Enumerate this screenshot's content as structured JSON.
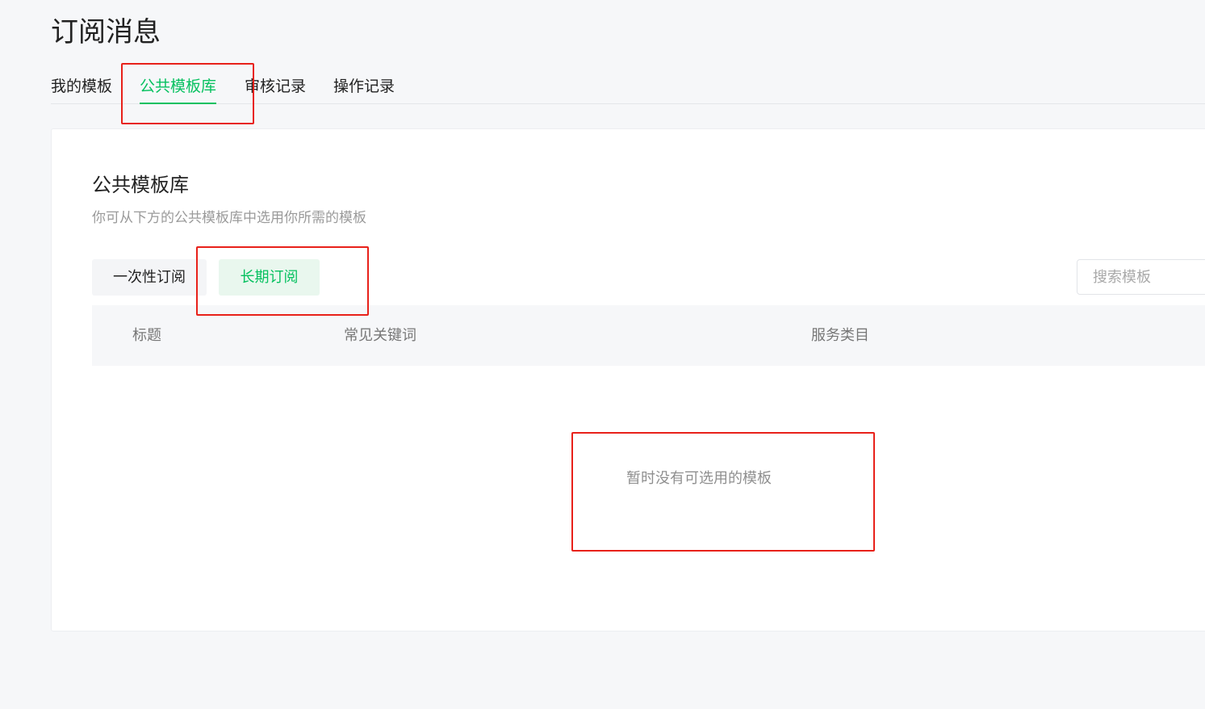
{
  "page": {
    "title": "订阅消息"
  },
  "top_tabs": [
    {
      "label": "我的模板",
      "active": false
    },
    {
      "label": "公共模板库",
      "active": true
    },
    {
      "label": "审核记录",
      "active": false
    },
    {
      "label": "操作记录",
      "active": false
    }
  ],
  "section": {
    "title": "公共模板库",
    "description": "你可从下方的公共模板库中选用你所需的模板"
  },
  "sub_tabs": [
    {
      "label": "一次性订阅",
      "active": false
    },
    {
      "label": "长期订阅",
      "active": true
    }
  ],
  "search": {
    "placeholder": "搜索模板",
    "value": ""
  },
  "table": {
    "columns": [
      "标题",
      "常见关键词",
      "服务类目"
    ],
    "rows": [],
    "empty_text": "暂时没有可选用的模板"
  },
  "colors": {
    "accent": "#07c160",
    "accent_bg": "#e9f7ee",
    "annotation": "#e8211a",
    "page_bg": "#f6f7f9"
  }
}
